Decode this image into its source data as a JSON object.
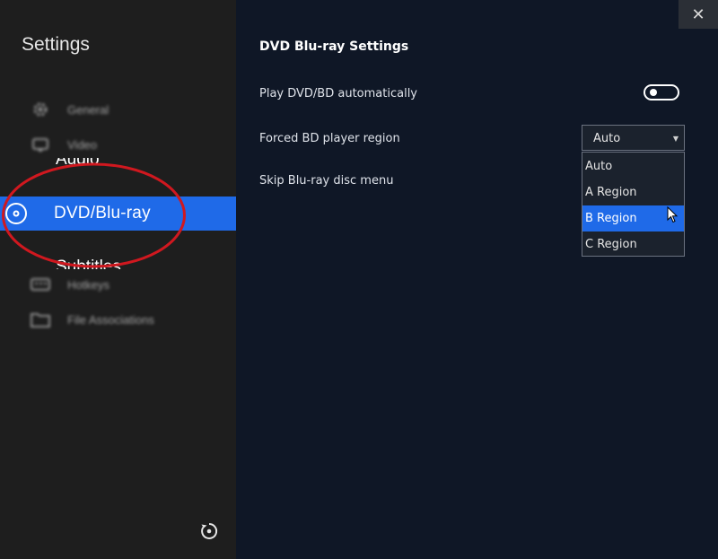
{
  "sidebar": {
    "title": "Settings",
    "items": [
      {
        "label": "General",
        "icon": "gear-icon"
      },
      {
        "label": "Video",
        "icon": "video-icon"
      },
      {
        "label": "Audio",
        "icon": "audio-icon"
      },
      {
        "label": "DVD/Blu-ray",
        "icon": "disc-icon",
        "active": true
      },
      {
        "label": "Subtitles",
        "icon": "subtitles-icon"
      },
      {
        "label": "Hotkeys",
        "icon": "keyboard-icon"
      },
      {
        "label": "File Associations",
        "icon": "folder-icon"
      }
    ],
    "reset_icon": "reset-icon"
  },
  "window": {
    "close_label": "✕"
  },
  "main": {
    "title": "DVD Blu-ray Settings",
    "settings": [
      {
        "label": "Play DVD/BD automatically",
        "control": "toggle",
        "value": "off"
      },
      {
        "label": "Forced BD player region",
        "control": "select"
      },
      {
        "label": "Skip Blu-ray disc menu"
      }
    ],
    "region_select": {
      "value": "Auto",
      "options": [
        "Auto",
        "A Region",
        "B Region",
        "C Region"
      ],
      "highlighted": "B Region"
    }
  },
  "colors": {
    "accent": "#1f6ae8",
    "sidebar_bg": "#1e1e1e",
    "main_bg": "#0f1726",
    "annotation": "#d0181f"
  }
}
